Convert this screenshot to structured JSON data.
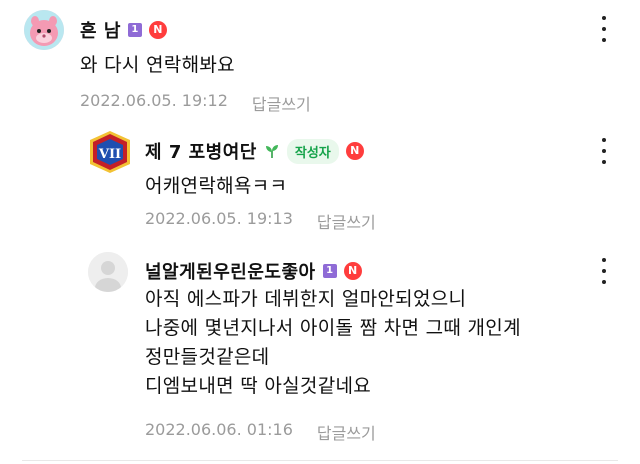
{
  "comments": [
    {
      "author": "흔 남",
      "level_badge": "1",
      "new_badge": "N",
      "text_lines": [
        "와 다시 연락해봐요"
      ],
      "timestamp": "2022.06.05. 19:12",
      "reply_label": "답글쓰기"
    },
    {
      "author": "제 7 포병여단",
      "author_tag": "작성자",
      "new_badge": "N",
      "avatar_text": "VII",
      "text_lines": [
        "어캐연락해욕ㅋㅋ"
      ],
      "timestamp": "2022.06.05. 19:13",
      "reply_label": "답글쓰기"
    },
    {
      "author": "널알게된우린운도좋아",
      "level_badge": "1",
      "new_badge": "N",
      "text_lines": [
        "아직 에스파가 데뷔한지 얼마안되었으니",
        "나중에 몇년지나서 아이돌 짬 차면 그때 개인계",
        "정만들것같은데",
        "디엠보내면 딱 아실것같네요"
      ],
      "timestamp": "2022.06.06. 01:16",
      "reply_label": "답글쓰기"
    }
  ],
  "colors": {
    "level_badge": "#8f6bd6",
    "new_badge": "#ff3d3d",
    "author_tag_bg": "#e9f8ec",
    "author_tag_text": "#16a34a",
    "meta_text": "#9b9b9b"
  },
  "icons": {
    "more": "more-vertical-icon",
    "sprout": "sprout-icon",
    "avatar_1": "pink-character-avatar",
    "avatar_2": "military-emblem-avatar",
    "avatar_3": "default-user-avatar"
  }
}
